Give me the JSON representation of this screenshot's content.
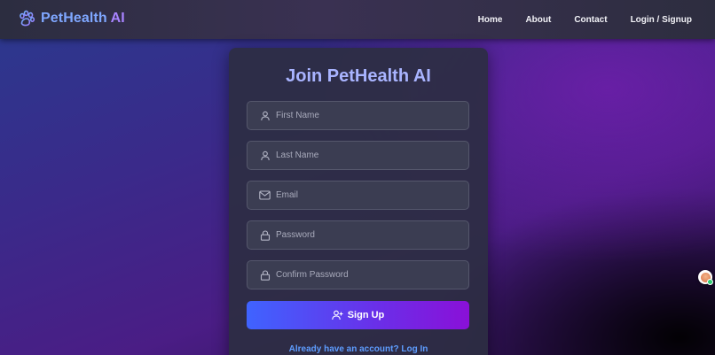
{
  "navbar": {
    "brand_main": "PetHealth ",
    "brand_ai": "AI",
    "brand_icon": "paw-icon",
    "links": [
      "Home",
      "About",
      "Contact",
      "Login / Signup"
    ]
  },
  "form": {
    "title": "Join PetHealth AI",
    "fields": [
      {
        "placeholder": "First Name",
        "value": "",
        "icon": "user-icon"
      },
      {
        "placeholder": "Last Name",
        "value": "",
        "icon": "user-icon"
      },
      {
        "placeholder": "Email",
        "value": "",
        "icon": "mail-icon"
      },
      {
        "placeholder": "Password",
        "value": "",
        "icon": "lock-icon"
      },
      {
        "placeholder": "Confirm Password",
        "value": "",
        "icon": "lock-icon"
      }
    ],
    "signup_label": "Sign Up",
    "signup_icon": "user-plus-icon",
    "login_link": "Already have an account? Log In"
  },
  "colors": {
    "accent_blue": "#7fa7ff",
    "accent_purple": "#a883ff",
    "title": "#a9b4ff",
    "link": "#5e9dff",
    "button_start": "#3f63ff",
    "button_end": "#8a10d8"
  },
  "floating_widget": {
    "icon": "avatar-icon",
    "status": "online"
  }
}
